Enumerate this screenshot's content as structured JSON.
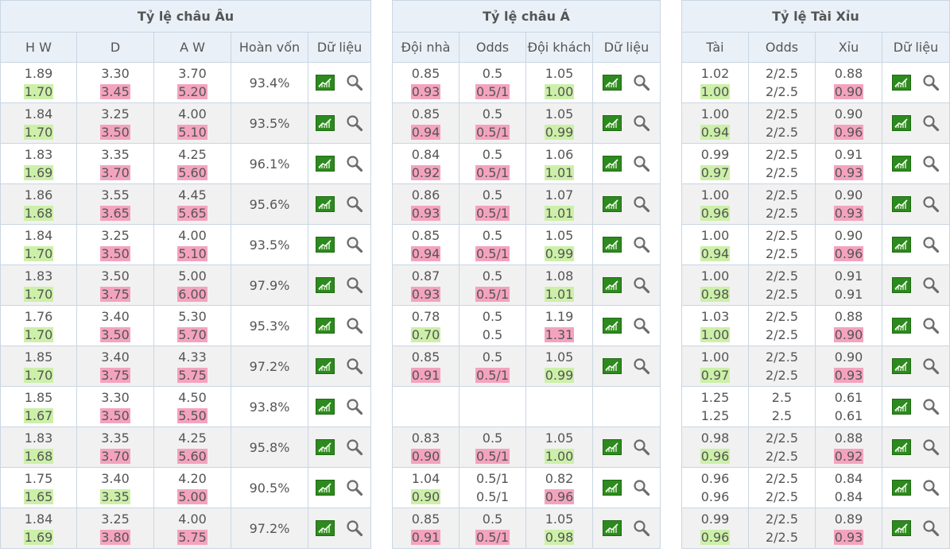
{
  "euro": {
    "title": "Tỷ lệ châu Âu",
    "headers": [
      "H W",
      "D",
      "A W",
      "Hoàn vốn",
      "Dữ liệu"
    ],
    "rows": [
      {
        "hw": [
          "1.89",
          "1.70"
        ],
        "d": [
          "3.30",
          "3.45"
        ],
        "aw": [
          "3.70",
          "5.20"
        ],
        "ret": "93.4%",
        "hw2c": "green",
        "d2c": "pink",
        "aw2c": "pink"
      },
      {
        "hw": [
          "1.84",
          "1.70"
        ],
        "d": [
          "3.25",
          "3.50"
        ],
        "aw": [
          "4.00",
          "5.10"
        ],
        "ret": "93.5%",
        "hw2c": "green",
        "d2c": "pink",
        "aw2c": "pink"
      },
      {
        "hw": [
          "1.83",
          "1.69"
        ],
        "d": [
          "3.35",
          "3.70"
        ],
        "aw": [
          "4.25",
          "5.60"
        ],
        "ret": "96.1%",
        "hw2c": "green",
        "d2c": "pink",
        "aw2c": "pink"
      },
      {
        "hw": [
          "1.86",
          "1.68"
        ],
        "d": [
          "3.55",
          "3.65"
        ],
        "aw": [
          "4.45",
          "5.65"
        ],
        "ret": "95.6%",
        "hw2c": "green",
        "d2c": "pink",
        "aw2c": "pink"
      },
      {
        "hw": [
          "1.84",
          "1.70"
        ],
        "d": [
          "3.25",
          "3.50"
        ],
        "aw": [
          "4.00",
          "5.10"
        ],
        "ret": "93.5%",
        "hw2c": "green",
        "d2c": "pink",
        "aw2c": "pink"
      },
      {
        "hw": [
          "1.83",
          "1.70"
        ],
        "d": [
          "3.50",
          "3.75"
        ],
        "aw": [
          "5.00",
          "6.00"
        ],
        "ret": "97.9%",
        "hw2c": "green",
        "d2c": "pink",
        "aw2c": "pink"
      },
      {
        "hw": [
          "1.76",
          "1.70"
        ],
        "d": [
          "3.40",
          "3.50"
        ],
        "aw": [
          "5.30",
          "5.70"
        ],
        "ret": "95.3%",
        "hw2c": "green",
        "d2c": "pink",
        "aw2c": "pink"
      },
      {
        "hw": [
          "1.85",
          "1.70"
        ],
        "d": [
          "3.40",
          "3.75"
        ],
        "aw": [
          "4.33",
          "5.75"
        ],
        "ret": "97.2%",
        "hw2c": "green",
        "d2c": "pink",
        "aw2c": "pink"
      },
      {
        "hw": [
          "1.85",
          "1.67"
        ],
        "d": [
          "3.30",
          "3.50"
        ],
        "aw": [
          "4.50",
          "5.50"
        ],
        "ret": "93.8%",
        "hw2c": "green",
        "d2c": "pink",
        "aw2c": "pink"
      },
      {
        "hw": [
          "1.83",
          "1.68"
        ],
        "d": [
          "3.35",
          "3.70"
        ],
        "aw": [
          "4.25",
          "5.60"
        ],
        "ret": "95.8%",
        "hw2c": "green",
        "d2c": "pink",
        "aw2c": "pink"
      },
      {
        "hw": [
          "1.75",
          "1.65"
        ],
        "d": [
          "3.40",
          "3.35"
        ],
        "aw": [
          "4.20",
          "5.00"
        ],
        "ret": "90.5%",
        "hw2c": "green",
        "d2c": "green",
        "aw2c": "pink"
      },
      {
        "hw": [
          "1.84",
          "1.69"
        ],
        "d": [
          "3.25",
          "3.80"
        ],
        "aw": [
          "4.00",
          "5.75"
        ],
        "ret": "97.2%",
        "hw2c": "green",
        "d2c": "pink",
        "aw2c": "pink"
      }
    ]
  },
  "asian": {
    "title": "Tỷ lệ châu Á",
    "headers": [
      "Đội nhà",
      "Odds",
      "Đội khách",
      "Dữ liệu"
    ],
    "rows": [
      {
        "home": [
          "0.85",
          "0.93"
        ],
        "odds": [
          "0.5",
          "0.5/1"
        ],
        "away": [
          "1.05",
          "1.00"
        ],
        "home2c": "pink",
        "odds2c": "pink",
        "away2c": "green",
        "icons": true
      },
      {
        "home": [
          "0.85",
          "0.94"
        ],
        "odds": [
          "0.5",
          "0.5/1"
        ],
        "away": [
          "1.05",
          "0.99"
        ],
        "home2c": "pink",
        "odds2c": "pink",
        "away2c": "green",
        "icons": true
      },
      {
        "home": [
          "0.84",
          "0.92"
        ],
        "odds": [
          "0.5",
          "0.5/1"
        ],
        "away": [
          "1.06",
          "1.01"
        ],
        "home2c": "pink",
        "odds2c": "pink",
        "away2c": "green",
        "icons": true
      },
      {
        "home": [
          "0.86",
          "0.93"
        ],
        "odds": [
          "0.5",
          "0.5/1"
        ],
        "away": [
          "1.07",
          "1.01"
        ],
        "home2c": "pink",
        "odds2c": "pink",
        "away2c": "green",
        "icons": true
      },
      {
        "home": [
          "0.85",
          "0.94"
        ],
        "odds": [
          "0.5",
          "0.5/1"
        ],
        "away": [
          "1.05",
          "0.99"
        ],
        "home2c": "pink",
        "odds2c": "pink",
        "away2c": "green",
        "icons": true
      },
      {
        "home": [
          "0.87",
          "0.93"
        ],
        "odds": [
          "0.5",
          "0.5/1"
        ],
        "away": [
          "1.08",
          "1.01"
        ],
        "home2c": "pink",
        "odds2c": "pink",
        "away2c": "green",
        "icons": true
      },
      {
        "home": [
          "0.78",
          "0.70"
        ],
        "odds": [
          "0.5",
          "0.5"
        ],
        "away": [
          "1.19",
          "1.31"
        ],
        "home2c": "green",
        "odds2c": "",
        "away2c": "pink",
        "icons": true
      },
      {
        "home": [
          "0.85",
          "0.91"
        ],
        "odds": [
          "0.5",
          "0.5/1"
        ],
        "away": [
          "1.05",
          "0.99"
        ],
        "home2c": "pink",
        "odds2c": "pink",
        "away2c": "green",
        "icons": true
      },
      {
        "home": [
          "",
          ""
        ],
        "odds": [
          "",
          ""
        ],
        "away": [
          "",
          ""
        ],
        "home2c": "",
        "odds2c": "",
        "away2c": "",
        "icons": false
      },
      {
        "home": [
          "0.83",
          "0.90"
        ],
        "odds": [
          "0.5",
          "0.5/1"
        ],
        "away": [
          "1.05",
          "1.00"
        ],
        "home2c": "pink",
        "odds2c": "pink",
        "away2c": "green",
        "icons": true
      },
      {
        "home": [
          "1.04",
          "0.90"
        ],
        "odds": [
          "0.5/1",
          "0.5/1"
        ],
        "away": [
          "0.82",
          "0.96"
        ],
        "home2c": "green",
        "odds2c": "",
        "away2c": "pink",
        "icons": true
      },
      {
        "home": [
          "0.85",
          "0.91"
        ],
        "odds": [
          "0.5",
          "0.5/1"
        ],
        "away": [
          "1.05",
          "0.98"
        ],
        "home2c": "pink",
        "odds2c": "pink",
        "away2c": "green",
        "icons": true
      }
    ]
  },
  "ou": {
    "title": "Tỷ lệ Tài Xỉu",
    "headers": [
      "Tài",
      "Odds",
      "Xỉu",
      "Dữ liệu"
    ],
    "rows": [
      {
        "over": [
          "1.02",
          "1.00"
        ],
        "odds": [
          "2/2.5",
          "2/2.5"
        ],
        "under": [
          "0.88",
          "0.90"
        ],
        "over2c": "green",
        "under2c": "pink"
      },
      {
        "over": [
          "1.00",
          "0.94"
        ],
        "odds": [
          "2/2.5",
          "2/2.5"
        ],
        "under": [
          "0.90",
          "0.96"
        ],
        "over2c": "green",
        "under2c": "pink"
      },
      {
        "over": [
          "0.99",
          "0.97"
        ],
        "odds": [
          "2/2.5",
          "2/2.5"
        ],
        "under": [
          "0.91",
          "0.93"
        ],
        "over2c": "green",
        "under2c": "pink"
      },
      {
        "over": [
          "1.00",
          "0.96"
        ],
        "odds": [
          "2/2.5",
          "2/2.5"
        ],
        "under": [
          "0.90",
          "0.93"
        ],
        "over2c": "green",
        "under2c": "pink"
      },
      {
        "over": [
          "1.00",
          "0.94"
        ],
        "odds": [
          "2/2.5",
          "2/2.5"
        ],
        "under": [
          "0.90",
          "0.96"
        ],
        "over2c": "green",
        "under2c": "pink"
      },
      {
        "over": [
          "1.00",
          "0.98"
        ],
        "odds": [
          "2/2.5",
          "2/2.5"
        ],
        "under": [
          "0.91",
          "0.91"
        ],
        "over2c": "green",
        "under2c": ""
      },
      {
        "over": [
          "1.03",
          "1.00"
        ],
        "odds": [
          "2/2.5",
          "2/2.5"
        ],
        "under": [
          "0.88",
          "0.90"
        ],
        "over2c": "green",
        "under2c": "pink"
      },
      {
        "over": [
          "1.00",
          "0.97"
        ],
        "odds": [
          "2/2.5",
          "2/2.5"
        ],
        "under": [
          "0.90",
          "0.93"
        ],
        "over2c": "green",
        "under2c": "pink"
      },
      {
        "over": [
          "1.25",
          "1.25"
        ],
        "odds": [
          "2.5",
          "2.5"
        ],
        "under": [
          "0.61",
          "0.61"
        ],
        "over2c": "",
        "under2c": ""
      },
      {
        "over": [
          "0.98",
          "0.96"
        ],
        "odds": [
          "2/2.5",
          "2/2.5"
        ],
        "under": [
          "0.88",
          "0.92"
        ],
        "over2c": "green",
        "under2c": "pink"
      },
      {
        "over": [
          "0.96",
          "0.96"
        ],
        "odds": [
          "2/2.5",
          "2/2.5"
        ],
        "under": [
          "0.84",
          "0.84"
        ],
        "over2c": "",
        "under2c": ""
      },
      {
        "over": [
          "0.99",
          "0.96"
        ],
        "odds": [
          "2/2.5",
          "2/2.5"
        ],
        "under": [
          "0.89",
          "0.93"
        ],
        "over2c": "green",
        "under2c": "pink"
      }
    ]
  },
  "icons": {
    "chart": "chart-icon",
    "search": "search-icon"
  },
  "colors": {
    "header_bg": "#e9f0f7",
    "border": "#c9d6e3",
    "green_hl": "#ccf0a8",
    "pink_hl": "#f4a3be",
    "alt_row": "#f1f1f1",
    "chart_icon": "#2d8a1e"
  }
}
